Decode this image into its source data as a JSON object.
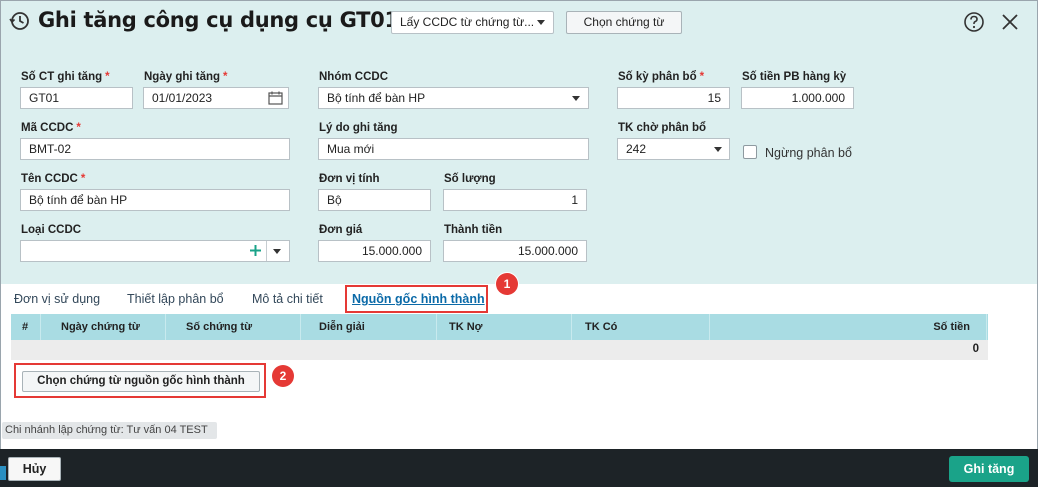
{
  "header": {
    "title": "Ghi tăng công cụ dụng cụ GT01",
    "source_select": "Lấy CCDC từ chứng từ...",
    "choose_voucher": "Chọn chứng từ"
  },
  "form": {
    "so_ct_label": "Số CT ghi tăng",
    "so_ct_value": "GT01",
    "ngay_label": "Ngày ghi tăng",
    "ngay_value": "01/01/2023",
    "nhom_label": "Nhóm CCDC",
    "nhom_value": "Bộ tính để bàn HP",
    "so_ky_label": "Số kỳ phân bổ",
    "so_ky_value": "15",
    "so_tien_pb_label": "Số tiền PB hàng kỳ",
    "so_tien_pb_value": "1.000.000",
    "ma_label": "Mã CCDC",
    "ma_value": "BMT-02",
    "ly_do_label": "Lý do ghi tăng",
    "ly_do_value": "Mua mới",
    "tk_cho_label": "TK chờ phân bổ",
    "tk_cho_value": "242",
    "ngung_label": "Ngừng phân bổ",
    "ten_label": "Tên CCDC",
    "ten_value": "Bộ tính để bàn HP",
    "dvt_label": "Đơn vị tính",
    "dvt_value": "Bộ",
    "so_luong_label": "Số lượng",
    "so_luong_value": "1",
    "loai_label": "Loại CCDC",
    "loai_value": "",
    "don_gia_label": "Đơn giá",
    "don_gia_value": "15.000.000",
    "thanh_tien_label": "Thành tiền",
    "thanh_tien_value": "15.000.000",
    "required_mark": "*"
  },
  "tabs": [
    {
      "label": "Đơn vị sử dụng"
    },
    {
      "label": "Thiết lập phân bổ"
    },
    {
      "label": "Mô tả chi tiết"
    },
    {
      "label": "Nguồn gốc hình thành"
    }
  ],
  "table": {
    "columns": [
      "#",
      "Ngày chứng từ",
      "Số chứng từ",
      "Diễn giải",
      "TK Nợ",
      "TK Có",
      "Số tiền"
    ],
    "total": "0"
  },
  "source_button": "Chọn chứng từ nguồn gốc hình thành",
  "branch_text": "Chi nhánh lập chứng từ: Tư vấn 04 TEST",
  "callouts": [
    "1",
    "2"
  ],
  "footer": {
    "cancel": "Hủy",
    "save": "Ghi tăng"
  },
  "colors": {
    "panel": "#dcefef",
    "table_header": "#a9dce3",
    "accent": "#1aa389",
    "callout": "#e53935"
  }
}
